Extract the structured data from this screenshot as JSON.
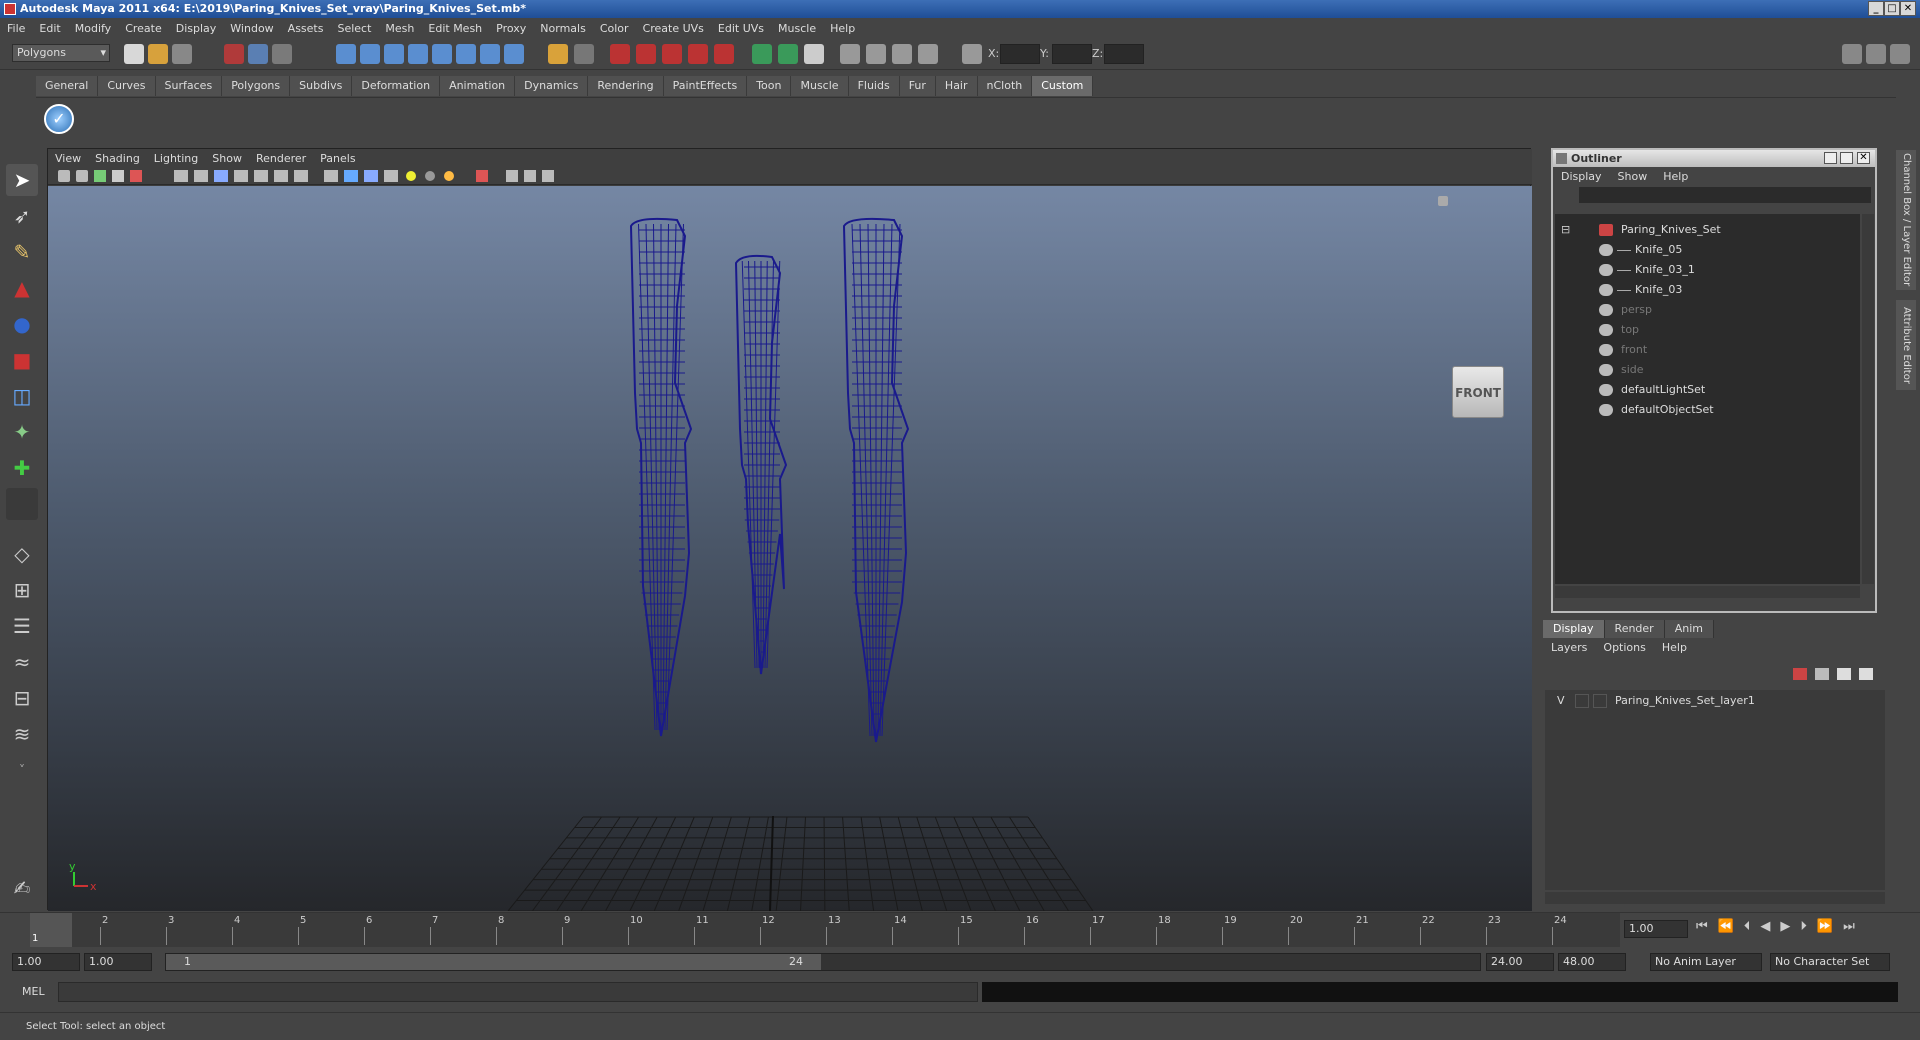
{
  "title": "Autodesk Maya 2011 x64: E:\\2019\\Paring_Knives_Set_vray\\Paring_Knives_Set.mb*",
  "menubar": [
    "File",
    "Edit",
    "Modify",
    "Create",
    "Display",
    "Window",
    "Assets",
    "Select",
    "Mesh",
    "Edit Mesh",
    "Proxy",
    "Normals",
    "Color",
    "Create UVs",
    "Edit UVs",
    "Muscle",
    "Help"
  ],
  "status": {
    "mode": "Polygons",
    "x_label": "X:",
    "y_label": "Y:",
    "z_label": "Z:"
  },
  "shelf_tabs": [
    "General",
    "Curves",
    "Surfaces",
    "Polygons",
    "Subdivs",
    "Deformation",
    "Animation",
    "Dynamics",
    "Rendering",
    "PaintEffects",
    "Toon",
    "Muscle",
    "Fluids",
    "Fur",
    "Hair",
    "nCloth",
    "Custom"
  ],
  "shelf_active": "Custom",
  "viewport": {
    "menu": [
      "View",
      "Shading",
      "Lighting",
      "Show",
      "Renderer",
      "Panels"
    ],
    "viewcube_label": "FRONT",
    "axis_y": "y",
    "axis_x": "x",
    "wire_color": "#1a1a8c"
  },
  "outliner": {
    "title": "Outliner",
    "menu": [
      "Display",
      "Show",
      "Help"
    ],
    "items": [
      {
        "label": "Paring_Knives_Set",
        "indent": 0,
        "dim": false
      },
      {
        "label": "Knife_05",
        "indent": 1,
        "dim": false
      },
      {
        "label": "Knife_03_1",
        "indent": 1,
        "dim": false
      },
      {
        "label": "Knife_03",
        "indent": 1,
        "dim": false
      },
      {
        "label": "persp",
        "indent": 0,
        "dim": true
      },
      {
        "label": "top",
        "indent": 0,
        "dim": true
      },
      {
        "label": "front",
        "indent": 0,
        "dim": true
      },
      {
        "label": "side",
        "indent": 0,
        "dim": true
      },
      {
        "label": "defaultLightSet",
        "indent": 0,
        "dim": false
      },
      {
        "label": "defaultObjectSet",
        "indent": 0,
        "dim": false
      }
    ]
  },
  "side_tabs": [
    "Channel Box / Layer Editor",
    "Attribute Editor"
  ],
  "layer_editor": {
    "tabs": [
      "Display",
      "Render",
      "Anim"
    ],
    "active": "Display",
    "menu": [
      "Layers",
      "Options",
      "Help"
    ],
    "layer": {
      "visible": "V",
      "name": "Paring_Knives_Set_layer1"
    }
  },
  "time": {
    "ticks": [
      "1",
      "2",
      "3",
      "4",
      "5",
      "6",
      "7",
      "8",
      "9",
      "10",
      "11",
      "12",
      "13",
      "14",
      "15",
      "16",
      "17",
      "18",
      "19",
      "20",
      "21",
      "22",
      "23",
      "24"
    ],
    "current": "1",
    "current_field": "1.00",
    "range_start": "1.00",
    "range_start2": "1.00",
    "range_slider_start": "1",
    "range_slider_end": "24",
    "range_end": "24.00",
    "range_end2": "48.00",
    "anim_layer": "No Anim Layer",
    "char_set": "No Character Set"
  },
  "cmd": {
    "label": "MEL"
  },
  "help_line": "Select Tool: select an object"
}
